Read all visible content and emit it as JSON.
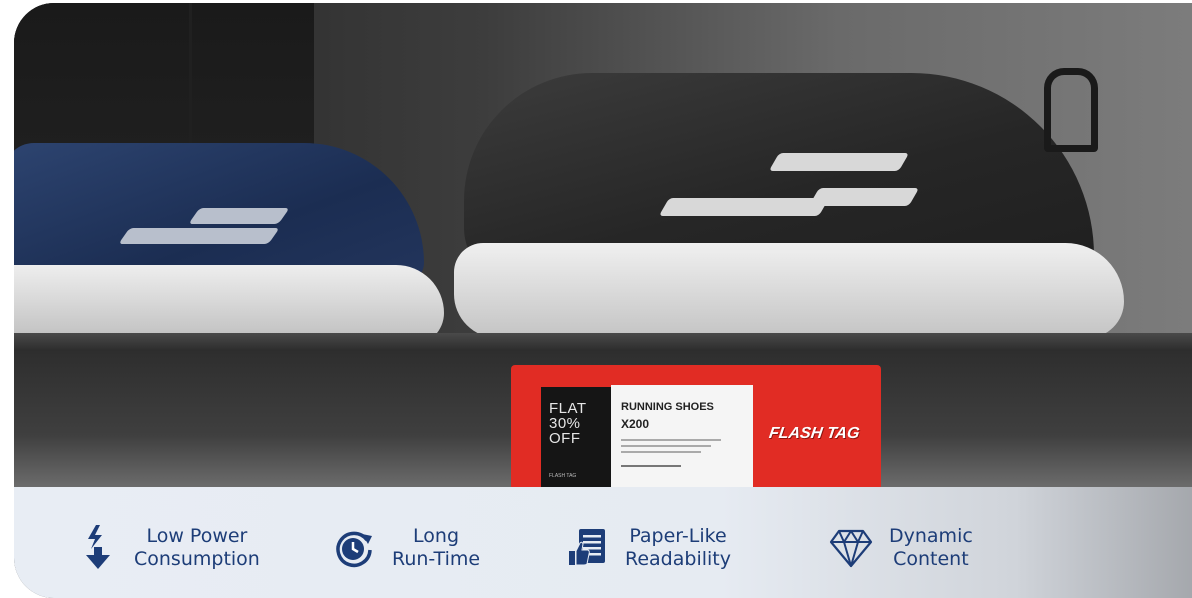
{
  "tag": {
    "offer": "FLAT\n30%\nOFF",
    "brand_mini": "FLASH TAG",
    "product_title": "RUNNING SHOES",
    "product_model": "X200",
    "logo": "FLASH TAG"
  },
  "features": [
    {
      "icon": "lightning-download-icon",
      "line1": "Low Power",
      "line2": "Consumption"
    },
    {
      "icon": "clock-refresh-icon",
      "line1": "Long",
      "line2": "Run-Time"
    },
    {
      "icon": "document-thumb-icon",
      "line1": "Paper-Like",
      "line2": "Readability"
    },
    {
      "icon": "diamond-icon",
      "line1": "Dynamic",
      "line2": "Content"
    }
  ],
  "colors": {
    "accent": "#1d3d78",
    "tag_red": "#e12c24",
    "bar_bg": "#e8edf4"
  }
}
